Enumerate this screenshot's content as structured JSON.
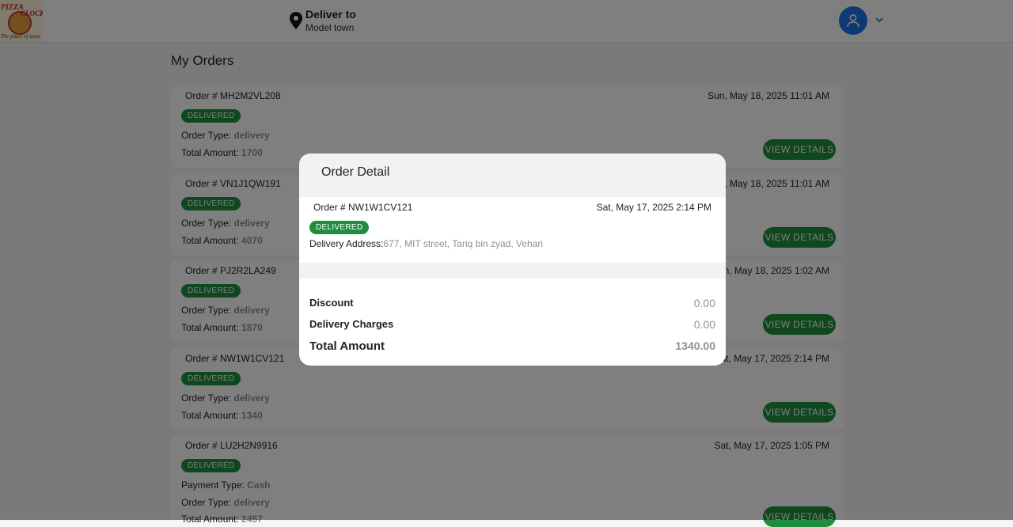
{
  "header": {
    "logo_text_1": "PIZZA",
    "logo_text_2": "CLOCK",
    "logo_tagline": "The place of taste",
    "deliver_to_label": "Deliver to",
    "deliver_to_location": "Model town"
  },
  "page": {
    "title": "My Orders"
  },
  "orders": [
    {
      "order_no": "Order # MH2M2VL208",
      "date": "Sun, May 18, 2025 11:01 AM",
      "status": "DELIVERED",
      "order_type_label": "Order Type: ",
      "order_type": "delivery",
      "total_label": "Total Amount: ",
      "total": "1700",
      "button": "VIEW DETAILS"
    },
    {
      "order_no": "Order # VN1J1QW191",
      "date": "Sun, May 18, 2025 11:01 AM",
      "status": "DELIVERED",
      "order_type_label": "Order Type: ",
      "order_type": "delivery",
      "total_label": "Total Amount: ",
      "total": "4070",
      "button": "VIEW DETAILS"
    },
    {
      "order_no": "Order # PJ2R2LA249",
      "date": "Sun, May 18, 2025 1:02 AM",
      "status": "DELIVERED",
      "order_type_label": "Order Type: ",
      "order_type": "delivery",
      "total_label": "Total Amount: ",
      "total": "1870",
      "button": "VIEW DETAILS"
    },
    {
      "order_no": "Order # NW1W1CV121",
      "date": "Sat, May 17, 2025 2:14 PM",
      "status": "DELIVERED",
      "order_type_label": "Order Type: ",
      "order_type": "delivery",
      "total_label": "Total Amount: ",
      "total": "1340",
      "button": "VIEW DETAILS"
    },
    {
      "order_no": "Order # LU2H2N9916",
      "date": "Sat, May 17, 2025 1:05 PM",
      "status": "DELIVERED",
      "payment_type_label": "Payment Type: ",
      "payment_type": "Cash",
      "order_type_label": "Order Type: ",
      "order_type": "delivery",
      "total_label": "Total Amount: ",
      "total": "2457",
      "button": "VIEW DETAILS"
    }
  ],
  "modal": {
    "title": "Order Detail",
    "order_no": "Order # NW1W1CV121",
    "date": "Sat, May 17, 2025 2:14 PM",
    "status": "DELIVERED",
    "address_label": "Delivery Address:",
    "address": "677, MIT street, Tariq bin zyad, Vehari",
    "discount_label": "Discount",
    "discount": "0.00",
    "delivery_charges_label": "Delivery Charges",
    "delivery_charges": "0.00",
    "total_label": "Total Amount",
    "total": "1340.00"
  },
  "colors": {
    "accent_green": "#1e8e3e",
    "avatar_blue": "#1a73e8",
    "muted_value": "#8a9299"
  },
  "icons": [
    "location-pin-icon",
    "user-icon",
    "chevron-down-icon"
  ]
}
